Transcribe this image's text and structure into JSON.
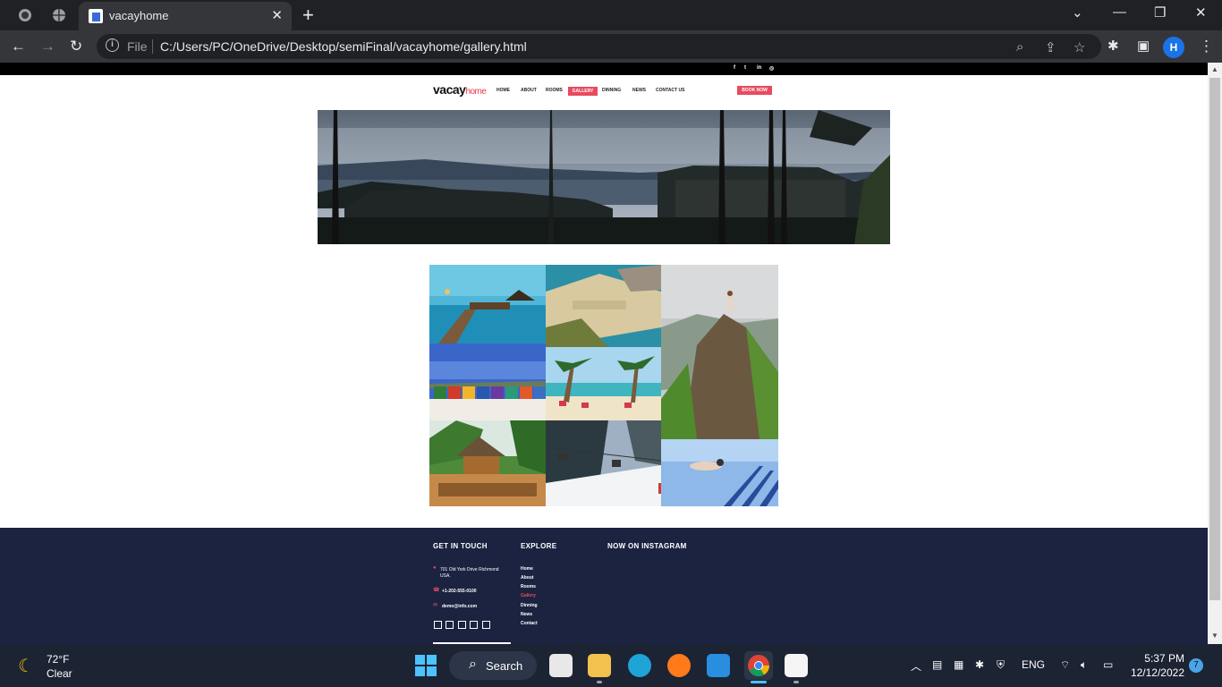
{
  "browser": {
    "tab_title": "vacayhome",
    "scheme_label": "File",
    "url": "C:/Users/PC/OneDrive/Desktop/semiFinal/vacayhome/gallery.html",
    "profile_initial": "H"
  },
  "site": {
    "logo_main": "vacay",
    "logo_sub": "home",
    "nav": [
      "HOME",
      "ABOUT",
      "ROOMS",
      "GALLERY",
      "DINNING",
      "NEWS",
      "CONTACT US"
    ],
    "active_nav": "GALLERY",
    "book_button": "BOOK NOW",
    "top_social_icons": [
      "facebook-icon",
      "twitter-icon",
      "linkedin-icon",
      "instagram-icon"
    ]
  },
  "gallery": {
    "images": [
      "tropical-pier",
      "rocky-beach",
      "mountain-hiker",
      "beach-huts",
      "palm-beach",
      "waterpark-hut",
      "ski-lift",
      "underwater-swimmer"
    ]
  },
  "footer": {
    "col1_heading": "GET IN TOUCH",
    "address": "701 Old York Drive Richmond",
    "address2": "USA.",
    "phone": "+1-202-555-0100",
    "email": "demo@info.com",
    "col2_heading": "EXPLORE",
    "links": [
      "Home",
      "About",
      "Rooms",
      "Gallery",
      "Dinning",
      "News",
      "Contact"
    ],
    "active_link": "Gallery",
    "col3_heading": "NOW ON INSTAGRAM"
  },
  "taskbar": {
    "temperature": "72°F",
    "condition": "Clear",
    "search_label": "Search",
    "language": "ENG",
    "time": "5:37 PM",
    "date": "12/12/2022",
    "notifications": "7"
  },
  "colors": {
    "accent": "#e84a5f",
    "footer_bg": "#1b2341",
    "chrome_dark": "#202124"
  }
}
